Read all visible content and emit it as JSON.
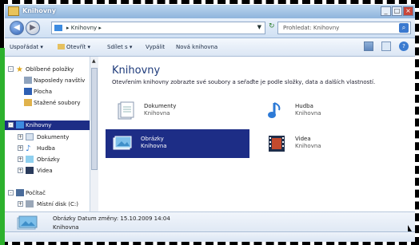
{
  "window": {
    "title": "Knihovny"
  },
  "address": {
    "path": "Knihovny",
    "search_placeholder": "Prohledat: Knihovny"
  },
  "toolbar": {
    "items": [
      "Uspořádat",
      "Otevřít",
      "Sdílet s",
      "Vypálit",
      "Nová knihovna"
    ]
  },
  "sidebar": {
    "favorites": "Oblíbené položky",
    "fav_items": [
      "Naposledy navštív",
      "Plocha",
      "Stažené soubory"
    ],
    "libraries": "Knihovny",
    "lib_items": [
      "Dokumenty",
      "Hudba",
      "Obrázky",
      "Videa"
    ],
    "computer": "Počítač",
    "comp_items": [
      "Místní disk (C:)"
    ]
  },
  "main": {
    "title": "Knihovny",
    "subtitle": "Otevřením knihovny zobrazte své soubory a seřaďte je podle složky, data a dalších vlastností.",
    "libraries": [
      {
        "name": "Dokumenty",
        "type": "Knihovna"
      },
      {
        "name": "Hudba",
        "type": "Knihovna"
      },
      {
        "name": "Obrázky",
        "type": "Knihovna"
      },
      {
        "name": "Videa",
        "type": "Knihovna"
      }
    ]
  },
  "details": {
    "name": "Obrázky",
    "date_label": "Datum změny:",
    "date_value": "15.10.2009 14:04",
    "type": "Knihovna"
  },
  "colors": {
    "selection": "#1d2d86",
    "accent": "#2db12d"
  }
}
